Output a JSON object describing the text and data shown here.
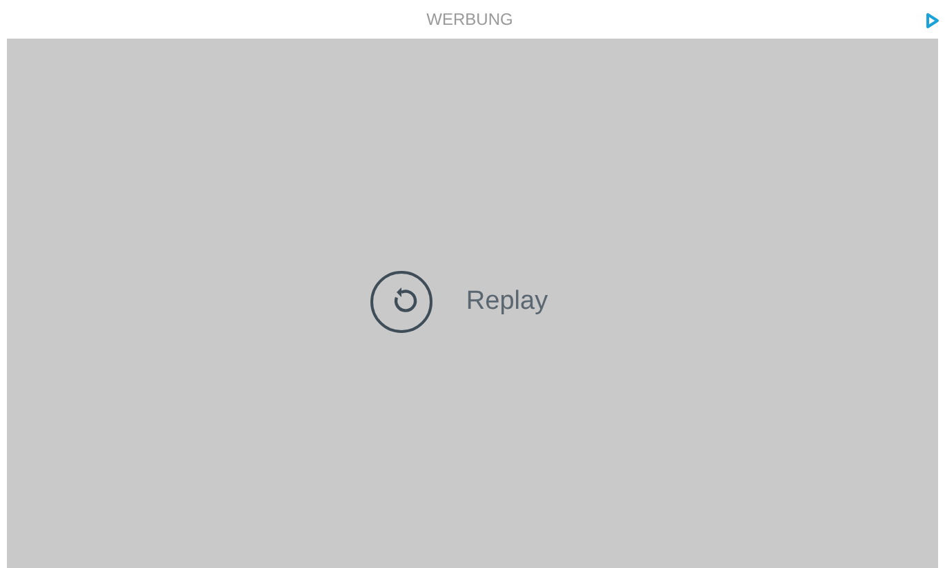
{
  "header": {
    "label": "WERBUNG"
  },
  "player": {
    "replay_label": "Replay"
  }
}
